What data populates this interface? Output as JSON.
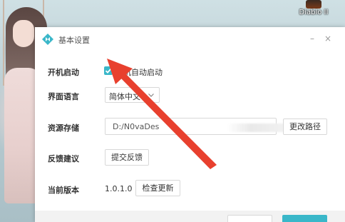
{
  "desktop": {
    "icon_label": "Diablo II"
  },
  "window": {
    "title": "基本设置",
    "minimize_glyph": "–",
    "close_glyph": "×"
  },
  "settings": {
    "autostart": {
      "label": "开机启动",
      "checkbox_label": "开机自动启动",
      "checked": true
    },
    "language": {
      "label": "界面语言",
      "value": "简体中文"
    },
    "storage": {
      "label": "资源存储",
      "path_value": "D:/N0vaDes",
      "change_button": "更改路径"
    },
    "feedback": {
      "label": "反馈建议",
      "button": "提交反馈"
    },
    "version": {
      "label": "当前版本",
      "value": "1.0.1.0",
      "check_button": "检查更新"
    }
  },
  "colors": {
    "accent": "#3ab7c9",
    "annotation": "#e8402e"
  }
}
